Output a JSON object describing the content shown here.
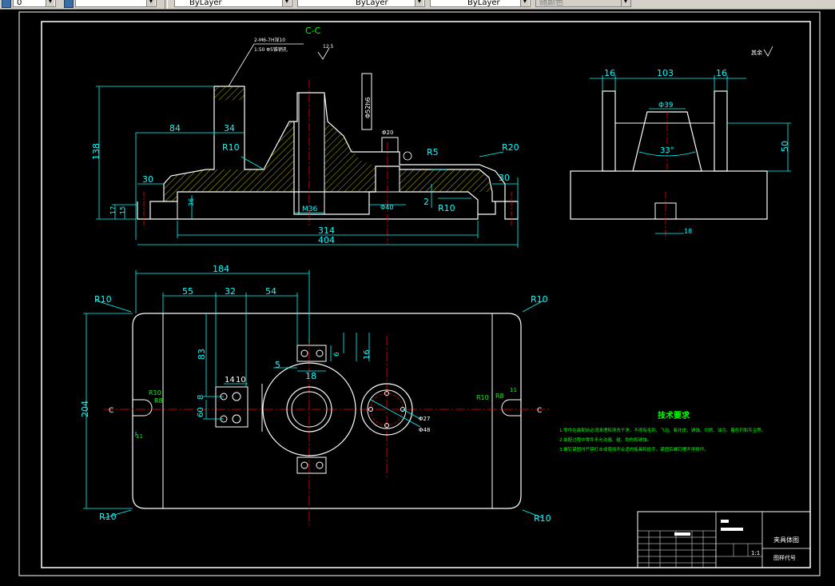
{
  "toolbar": {
    "layer_value": "0",
    "color_value": "ByLayer",
    "linetype_value": "ByLayer",
    "lineweight_value": "ByLayer",
    "plotstyle_value": "随颜色"
  },
  "drawing": {
    "section_label": "C-C",
    "section_note_1": "2-M6-7H深10",
    "section_note_2": "1:50 Φ5锥销孔",
    "roughness_section": "12.5",
    "roughness_top_right": "其余",
    "tech_title": "技术要求",
    "tech_items": [
      "1.零件在装配前必须清理和清洗干净，不得有毛刺、飞边、氧化皮、锈蚀、切屑、油污、着色剂和灰尘等。",
      "2.装配过程中零件不允许磕、碰、划伤和锈蚀。",
      "3.螺钉紧固时严禁打击或使用不合适的旋具和扳手。紧固后螺钉槽不得损坏。"
    ],
    "section_dims": {
      "d138": "138",
      "d84": "84",
      "d34": "34",
      "r10a": "R10",
      "r5": "R5",
      "r20": "R20",
      "d30a": "30",
      "d30b": "30",
      "d17": "17",
      "d15": "15",
      "d36": "36",
      "m36": "M36",
      "phi40": "Φ40",
      "d2": "2",
      "r10b": "R10",
      "d314": "314",
      "d404": "404",
      "phi20": "Φ20",
      "phi52": "Φ52h6"
    },
    "side_dims": {
      "d16a": "16",
      "d103": "103",
      "d16b": "16",
      "phi39": "Φ39",
      "ang33": "33°",
      "d50": "50",
      "d18": "18"
    },
    "plan_dims": {
      "d184": "184",
      "d55": "55",
      "d32": "32",
      "d54": "54",
      "r10_tl": "R10",
      "r10_tr": "R10",
      "r10_bl": "R10",
      "r10_br": "R10",
      "d204": "204",
      "d83": "83",
      "d8": "8",
      "d60": "60",
      "d14": "14",
      "d10": "10",
      "d5": "5",
      "d18": "18",
      "d6": "6",
      "d16": "16",
      "phi27": "Φ27",
      "phi48": "Φ48",
      "c_left": "C",
      "c_right": "C",
      "r10_slot_l": "R10",
      "r8_l": "R8",
      "d11_l": "11",
      "r10_slot_r": "R10",
      "r8_r": "R8",
      "d11_r": "11"
    },
    "title_block": {
      "name": "夹具体图",
      "drawing_no_label": "图样代号",
      "scale": "1:1"
    }
  },
  "colors": {
    "background": "#000000",
    "outline": "#ffffff",
    "dimension": "#00ffff",
    "hatch": "#ffff00",
    "centerline": "#ff0000",
    "note_text": "#00ff00"
  }
}
